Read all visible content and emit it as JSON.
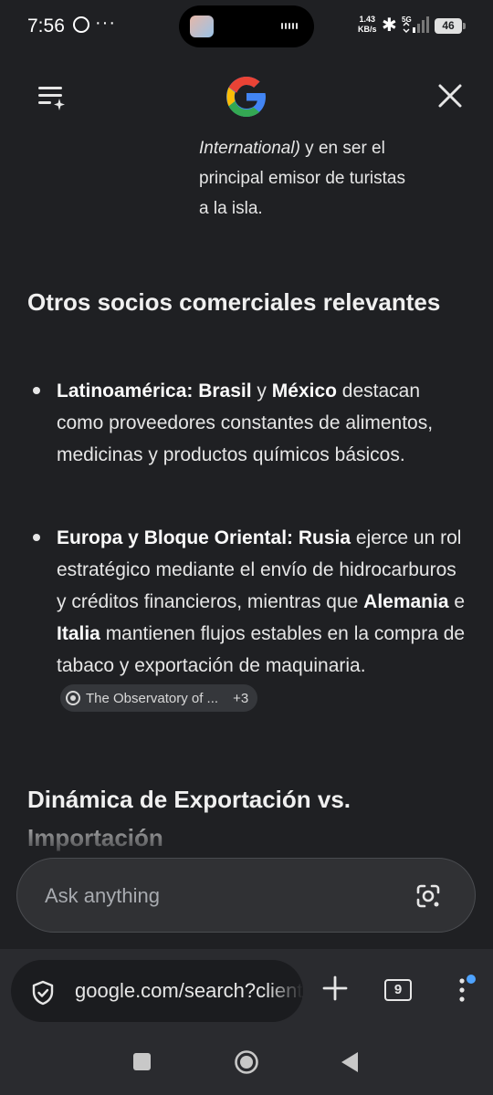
{
  "status_bar": {
    "time": "7:56",
    "more_dots": "···",
    "net_speed_value": "1.43",
    "net_speed_unit": "KB/s",
    "signal_label": "5G",
    "battery": "46"
  },
  "header": {
    "logo_icon": "google-g-icon",
    "menu_icon": "list-sparkle-icon",
    "close_icon": "close-icon"
  },
  "content": {
    "fragment_line1_italic": "International)",
    "fragment_line1_rest": " y en ser el",
    "fragment_line2": "principal emisor de turistas",
    "fragment_line3": "a la isla.",
    "section1_title": "Otros socios comerciales relevantes",
    "bullets": [
      {
        "b1": "Latinoamérica: Brasil",
        "t1": " y ",
        "b2": "México",
        "t2": " destacan como proveedores constantes de alimentos, medicinas y productos químicos básicos."
      },
      {
        "b1": "Europa y Bloque Oriental: Rusia",
        "t1": " ejerce un rol estratégico mediante el envío de hidrocarburos y créditos financieros, mientras que ",
        "b2": "Alemania",
        "t2": " e ",
        "b3": "Italia",
        "t3": " mantienen flujos estables en la compra de tabaco y exportación de maquinaria.",
        "source_chip": "The Observatory of ...",
        "source_more": "+3"
      }
    ],
    "section2_title": "Dinámica de Exportación vs. Importación"
  },
  "ask": {
    "placeholder": "Ask anything",
    "lens_icon": "google-lens-icon"
  },
  "browser": {
    "url": "google.com/search?client",
    "tab_count": "9",
    "accent_dot_color": "#4ea3ff"
  },
  "colors": {
    "background": "#1f2023",
    "google_blue": "#4285F4",
    "google_red": "#EA4335",
    "google_yellow": "#FBBC05",
    "google_green": "#34A853"
  }
}
